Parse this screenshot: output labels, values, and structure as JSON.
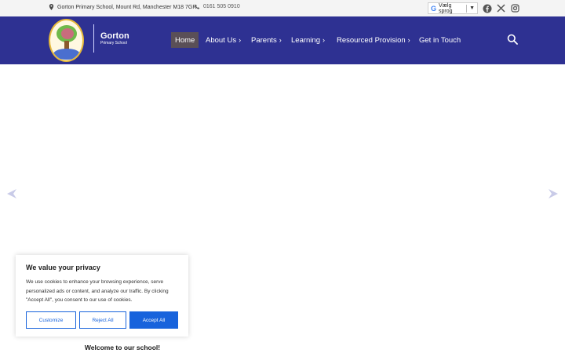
{
  "topbar": {
    "address": "Gorton Primary School, Mount Rd, Manchester M18 7GR",
    "phone": "0161 505 0910",
    "translate_label": "Vælg sprog",
    "social": [
      "facebook-icon",
      "x-icon",
      "instagram-icon"
    ]
  },
  "header": {
    "school_name": "Gorton",
    "school_sub": "Primary School",
    "nav": [
      {
        "label": "Home",
        "active": true
      },
      {
        "label": "About Us",
        "has_dropdown": true
      },
      {
        "label": "Parents",
        "has_dropdown": true
      },
      {
        "label": "Learning",
        "has_dropdown": true
      },
      {
        "label": "Resourced Provision",
        "has_dropdown": true
      },
      {
        "label": "Get in Touch"
      }
    ]
  },
  "cookie": {
    "title": "We value your privacy",
    "description": "We use cookies to enhance your browsing experience, serve personalized ads or content, and analyze our traffic. By clicking \"Accept All\", you consent to our use of cookies.",
    "customize_label": "Customize",
    "reject_label": "Reject All",
    "accept_label": "Accept All"
  },
  "main": {
    "welcome": "Welcome to our school!"
  },
  "colors": {
    "header_bg": "#2e3192",
    "active_nav_bg": "#5a4f57",
    "cookie_accent": "#1863dc"
  }
}
